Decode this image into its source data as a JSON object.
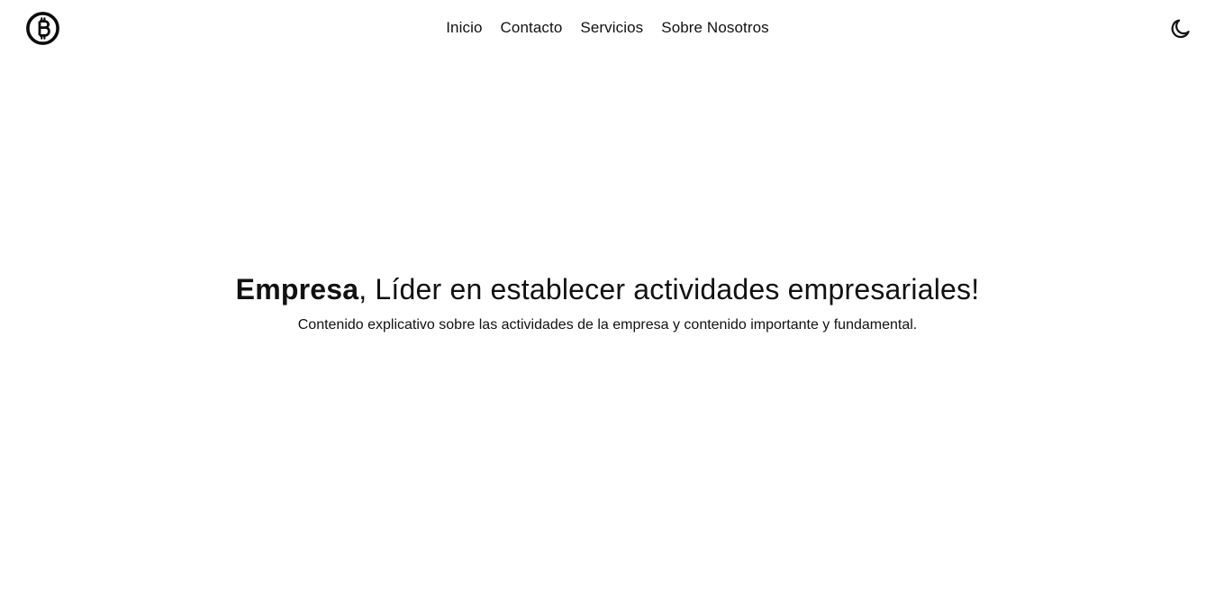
{
  "header": {
    "logo_icon": "bitcoin-icon",
    "nav": {
      "inicio": "Inicio",
      "contacto": "Contacto",
      "servicios": "Servicios",
      "sobre_nosotros": "Sobre Nosotros"
    },
    "theme_toggle_icon": "moon-icon"
  },
  "hero": {
    "title_bold": "Empresa",
    "title_rest": ", Líder en establecer actividades empresariales!",
    "description": "Contenido explicativo sobre las actividades de la empresa y contenido importante y fundamental."
  },
  "colors": {
    "background": "#ffffff",
    "text": "#111111"
  }
}
